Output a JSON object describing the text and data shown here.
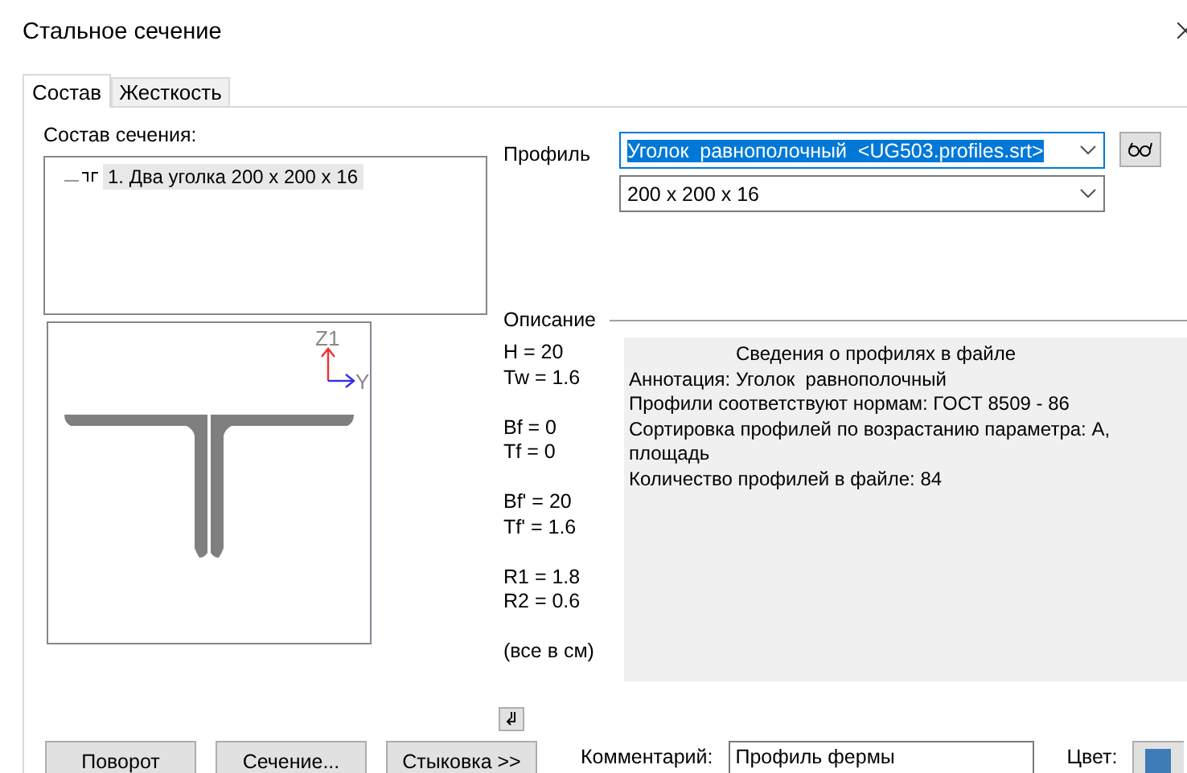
{
  "window": {
    "title": "Стальное сечение"
  },
  "tabs": [
    {
      "label": "Состав",
      "selected": true
    },
    {
      "label": "Жесткость",
      "selected": false
    }
  ],
  "composition": {
    "label": "Состав сечения:",
    "items": [
      {
        "label": "1. Два уголка 200 x 200 x 16",
        "selected": true
      }
    ]
  },
  "section_view": {
    "z_axis_label": "Z1",
    "y_axis_label": "Y"
  },
  "profile": {
    "label": "Профиль",
    "type_value": "Уголок  равнополочный  <UG503.profiles.srt>",
    "type_focused": true,
    "size_value": "200 x 200 x 16"
  },
  "description": {
    "label": "Описание",
    "parameters": [
      [
        "H = 20",
        "Tw = 1.6"
      ],
      [
        "Bf = 0",
        "Tf = 0"
      ],
      [
        "Bf' = 20",
        "Tf' = 1.6"
      ],
      [
        "R1 = 1.8",
        "R2 = 0.6"
      ],
      [
        "(все в см)"
      ]
    ],
    "info_title": "Сведения о профилях в файле",
    "info_lines": [
      "Аннотация: Уголок  равнополочный",
      "Профили соответствуют нормам: ГОСТ 8509 - 86",
      "Сортировка профилей по возрастанию параметра: А, площадь",
      "Количество профилей в файле: 84"
    ]
  },
  "buttons": [
    "Поворот",
    "Сечение...",
    "Стыковка >>"
  ],
  "comment": {
    "label": "Комментарий:",
    "value": "Профиль фермы"
  },
  "color": {
    "label": "Цвет:",
    "color": "#3e7cb8"
  }
}
